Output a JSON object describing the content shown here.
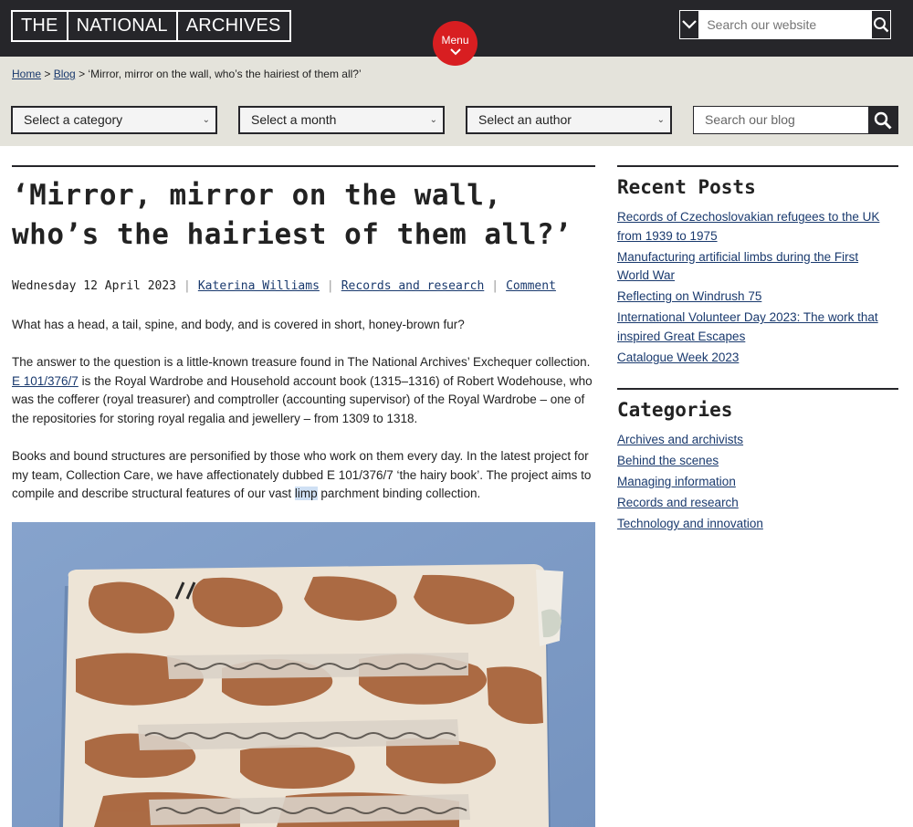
{
  "header": {
    "logo_words": [
      "THE",
      "NATIONAL",
      "ARCHIVES"
    ],
    "menu_label": "Menu",
    "site_search_placeholder": "Search our website"
  },
  "breadcrumb": {
    "home": "Home",
    "sep1": " > ",
    "blog": "Blog",
    "sep2": " > ",
    "current": "‘Mirror, mirror on the wall, who’s the hairiest of them all?’"
  },
  "filters": {
    "category": "Select a category",
    "month": "Select a month",
    "author": "Select an author",
    "blog_search_placeholder": "Search our blog"
  },
  "article": {
    "title": "‘Mirror, mirror on the wall, who’s the hairiest of them all?’",
    "date": "Wednesday 12 April 2023",
    "author": "Katerina Williams",
    "category": "Records and research",
    "comment": "Comment",
    "p1": "What has a head, a tail, spine, and body, and is covered in short, honey-brown fur?",
    "p2_before": "The answer to the question is a little-known treasure found in The National Archives’ Exchequer collection. ",
    "p2_link": "E 101/376/7",
    "p2_after": " is the Royal Wardrobe and Household account book (1315–1316) of Robert Wodehouse, who was the cofferer (royal treasurer) and comptroller (accounting supervisor) of the Royal Wardrobe – one of the repositories for storing royal regalia and jewellery – from 1309 to 1318.",
    "p3_before": "Books and bound structures are personified by those who work on them every day. In the latest project for my team, Collection Care, we have affectionately dubbed E 101/376/7 ‘the hairy book’. The project aims to compile and describe structural features of our vast ",
    "p3_highlight": "limp",
    "p3_after": " parchment binding collection."
  },
  "sidebar": {
    "recent_heading": "Recent Posts",
    "recent_posts": [
      "Records of Czechoslovakian refugees to the UK from 1939 to 1975",
      "Manufacturing artificial limbs during the First World War",
      "Reflecting on Windrush 75",
      "International Volunteer Day 2023: The work that inspired Great Escapes",
      "Catalogue Week 2023"
    ],
    "categories_heading": "Categories",
    "categories": [
      "Archives and archivists",
      "Behind the scenes",
      "Managing information",
      "Records and research",
      "Technology and innovation"
    ]
  },
  "colors": {
    "header_bg": "#26262a",
    "band_bg": "#e4e3db",
    "menu_red": "#d81e21",
    "link": "#1a3a6e",
    "photo_bg": "#7f9cc6"
  }
}
